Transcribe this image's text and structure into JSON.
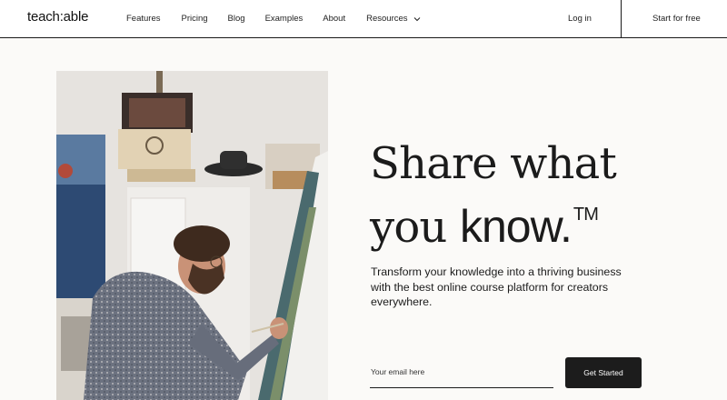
{
  "nav": {
    "logo": "teach:able",
    "links": [
      "Features",
      "Pricing",
      "Blog",
      "Examples",
      "About",
      "Resources"
    ],
    "login": "Log in",
    "cta": "Start for free"
  },
  "hero": {
    "headline_line1": "Share what",
    "headline_line2_a": "you",
    "headline_line2_b": "know.",
    "trademark": "TM",
    "subtext": "Transform your knowledge into a thriving business with the best online course platform for creators everywhere.",
    "email_placeholder": "Your email here",
    "button_label": "Get Started"
  },
  "colors": {
    "background": "#fbfaf8",
    "text": "#1b1b1b",
    "button": "#1c1c1c"
  },
  "icons": [
    "chevron-down-icon"
  ]
}
